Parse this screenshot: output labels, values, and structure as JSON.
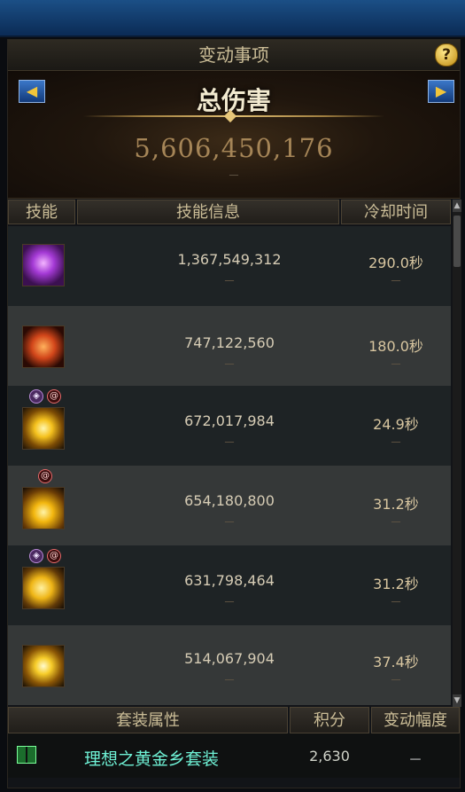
{
  "window": {
    "panel_title": "变动事项",
    "help_icon": "question-mark-icon",
    "help_label": "?"
  },
  "summary": {
    "metric_title": "总伤害",
    "total_value": "5,606,450,176",
    "dash": "－",
    "prev_icon": "triangle-left-icon",
    "next_icon": "triangle-right-icon",
    "prev_label": "◀",
    "next_label": "▶"
  },
  "table": {
    "headers": {
      "skill": "技能",
      "info": "技能信息",
      "cooldown": "冷却时间"
    },
    "rows": [
      {
        "icon": "purple-claw-skill-icon",
        "damage": "1,367,549,312",
        "cooldown": "290.0秒",
        "dash": "－",
        "badges": []
      },
      {
        "icon": "fire-beast-skill-icon",
        "damage": "747,122,560",
        "cooldown": "180.0秒",
        "dash": "－",
        "badges": []
      },
      {
        "icon": "golden-burst-skill-icon",
        "damage": "672,017,984",
        "cooldown": "24.9秒",
        "dash": "－",
        "badges": [
          "◈",
          "@"
        ]
      },
      {
        "icon": "golden-flame-skill-icon",
        "damage": "654,180,800",
        "cooldown": "31.2秒",
        "dash": "－",
        "badges": [
          "@"
        ]
      },
      {
        "icon": "golden-crescent-skill-icon",
        "damage": "631,798,464",
        "cooldown": "31.2秒",
        "dash": "－",
        "badges": [
          "◈",
          "@"
        ]
      },
      {
        "icon": "golden-starburst-skill-icon",
        "damage": "514,067,904",
        "cooldown": "37.4秒",
        "dash": "－",
        "badges": []
      }
    ]
  },
  "scrollbar": {
    "up_label": "▲",
    "down_label": "▼"
  },
  "set_section": {
    "headers": {
      "set": "套装属性",
      "score": "积分",
      "change": "变动幅度"
    },
    "item": {
      "icon": "set-equipment-icon",
      "name": "理想之黄金乡套装",
      "score": "2,630",
      "change": "－"
    }
  }
}
